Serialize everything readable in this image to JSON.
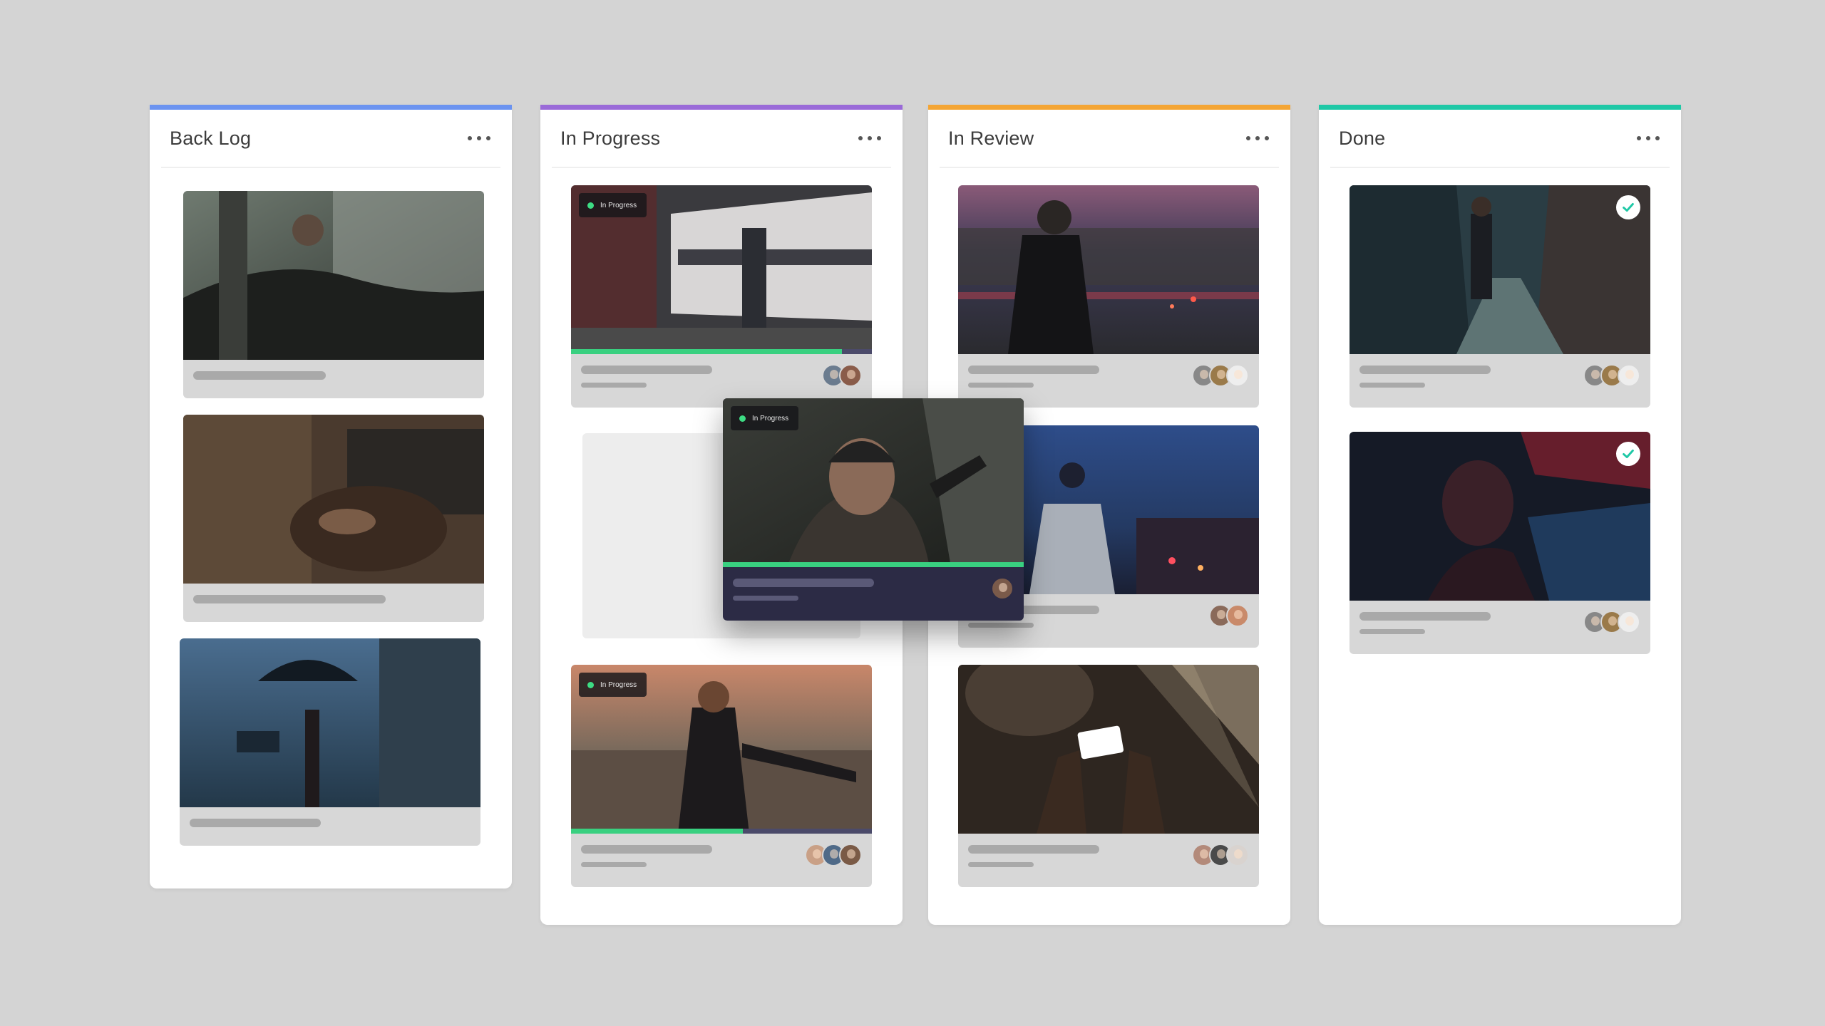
{
  "board": {
    "columns": [
      {
        "title": "Back Log",
        "accent": "#6b93f0"
      },
      {
        "title": "In Progress",
        "accent": "#9a6ad8"
      },
      {
        "title": "In Review",
        "accent": "#f4a534"
      },
      {
        "title": "Done",
        "accent": "#1ec8a6"
      }
    ]
  },
  "status_badge": {
    "label": "In Progress",
    "dot_color": "#3ddc84"
  },
  "cards": {
    "in_progress_progress": [
      0.9,
      0.57
    ],
    "drag_card_progress": 1.0
  },
  "icons": {
    "menu": "more-dots-icon",
    "done": "check-circle-icon"
  },
  "colors": {
    "background": "#d4d4d4",
    "progress": "#39d080",
    "progress_track": "#4b4a6a",
    "drag_card": "#2c2b45"
  }
}
